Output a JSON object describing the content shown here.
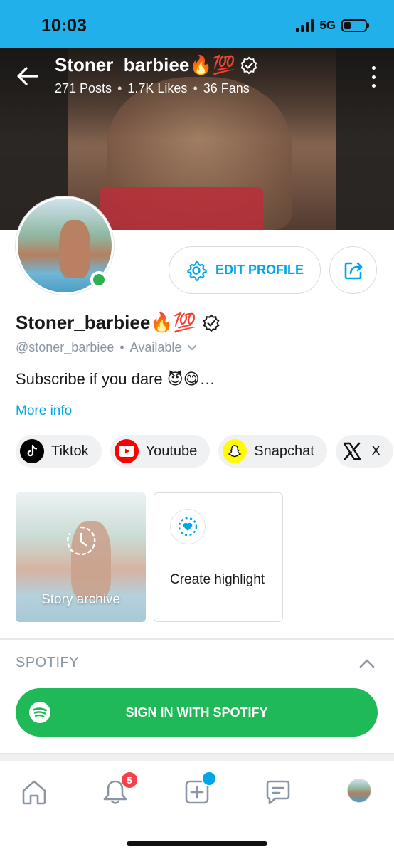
{
  "status_bar": {
    "time": "10:03",
    "network": "5G"
  },
  "header": {
    "name": "Stoner_barbiee🔥💯",
    "posts": "271 Posts",
    "likes": "1.7K Likes",
    "fans": "36 Fans",
    "separator": "•"
  },
  "profile": {
    "name": "Stoner_barbiee🔥💯",
    "handle": "@stoner_barbiee",
    "separator": "•",
    "status": "Available",
    "bio": "Subscribe if you dare 😈😋…",
    "more_info": "More info",
    "edit_label": "EDIT PROFILE",
    "online": true
  },
  "socials": [
    {
      "label": "Tiktok",
      "icon": "tiktok-icon",
      "color": "#000000"
    },
    {
      "label": "Youtube",
      "icon": "youtube-icon",
      "color": "#ff0000"
    },
    {
      "label": "Snapchat",
      "icon": "snapchat-icon",
      "color": "#fffc00"
    },
    {
      "label": "X",
      "icon": "x-icon",
      "color": "#000000"
    }
  ],
  "stories": {
    "archive_label": "Story archive",
    "highlight_label": "Create highlight"
  },
  "spotify": {
    "section_title": "SPOTIFY",
    "button_label": "SIGN IN WITH SPOTIFY"
  },
  "tabbar": {
    "notifications_badge": "5",
    "items": [
      "home-icon",
      "bell-icon",
      "add-post-icon",
      "messages-icon",
      "profile-avatar"
    ]
  },
  "colors": {
    "accent": "#00a6e6",
    "spotify": "#20b957",
    "status_bar": "#21b0ea",
    "badge": "#f34149"
  }
}
